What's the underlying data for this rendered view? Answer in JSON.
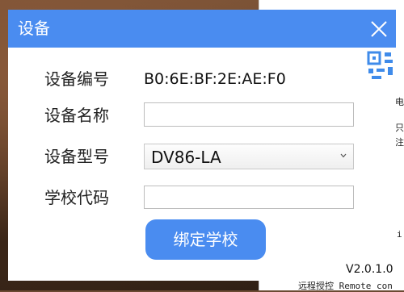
{
  "dialog": {
    "title": "设备",
    "fields": {
      "device_id_label": "设备编号",
      "device_id_value": "B0:6E:BF:2E:AE:F0",
      "device_name_label": "设备名称",
      "device_name_value": "",
      "device_model_label": "设备型号",
      "device_model_selected": "DV86-LA",
      "school_code_label": "学校代码",
      "school_code_value": ""
    },
    "bind_button_label": "绑定学校",
    "version": "V2.0.1.0"
  },
  "background": {
    "snippet_bottom": "远程授控 Remote con",
    "snippet_right_1": "电",
    "snippet_right_2": "只",
    "snippet_right_3": "注",
    "snippet_right_4": "i",
    "snippet_right_5": "con"
  },
  "colors": {
    "accent": "#4a8cf0",
    "title_text": "#ffffff"
  },
  "icons": [
    "close-icon",
    "dropdown-caret-icon",
    "qr-code-icon"
  ]
}
